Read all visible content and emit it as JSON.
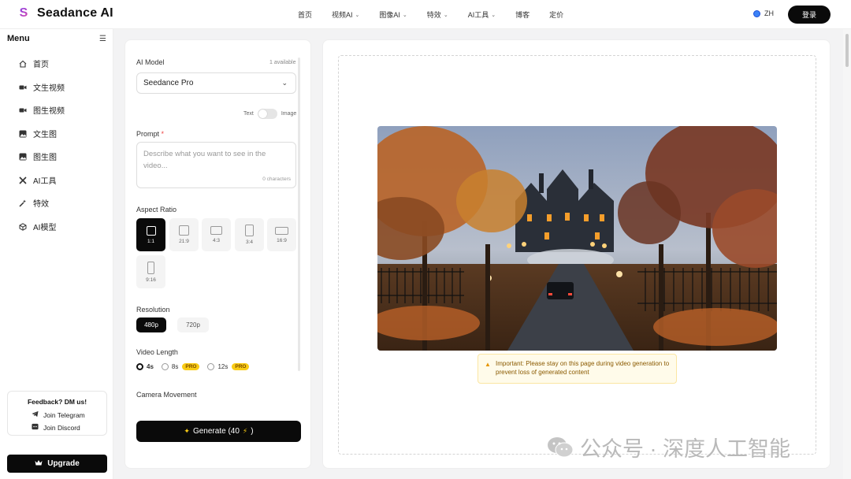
{
  "app": {
    "name": "Seadance AI",
    "logo_letter": "S"
  },
  "nav": {
    "items": [
      {
        "label": "首页",
        "has_dropdown": false
      },
      {
        "label": "视频AI",
        "has_dropdown": true
      },
      {
        "label": "图像AI",
        "has_dropdown": true
      },
      {
        "label": "特效",
        "has_dropdown": true
      },
      {
        "label": "AI工具",
        "has_dropdown": true
      },
      {
        "label": "博客",
        "has_dropdown": false
      },
      {
        "label": "定价",
        "has_dropdown": false
      }
    ],
    "language": "ZH",
    "login_label": "登录"
  },
  "sidebar": {
    "title": "Menu",
    "items": [
      {
        "label": "首页",
        "icon": "home-icon"
      },
      {
        "label": "文生视频",
        "icon": "video-icon"
      },
      {
        "label": "图生视频",
        "icon": "video-icon"
      },
      {
        "label": "文生图",
        "icon": "image-icon"
      },
      {
        "label": "图生图",
        "icon": "image-icon"
      },
      {
        "label": "AI工具",
        "icon": "tools-icon"
      },
      {
        "label": "特效",
        "icon": "magic-wand-icon"
      },
      {
        "label": "AI模型",
        "icon": "cube-icon"
      }
    ],
    "feedback": {
      "title": "Feedback? DM us!",
      "telegram": "Join Telegram",
      "discord": "Join Discord"
    },
    "upgrade_label": "Upgrade"
  },
  "form": {
    "model_label": "AI Model",
    "model_available": "1 available",
    "model_value": "Seedance Pro",
    "mode_text": "Text",
    "mode_image": "Image",
    "prompt_label": "Prompt",
    "prompt_required_mark": "*",
    "prompt_placeholder": "Describe what you want to see in the video...",
    "prompt_count": "0 characters",
    "aspect_label": "Aspect Ratio",
    "aspect_ratios": [
      "1:1",
      "21:9",
      "4:3",
      "3:4",
      "16:9",
      "9:16"
    ],
    "aspect_selected": "1:1",
    "resolution_label": "Resolution",
    "resolutions": [
      "480p",
      "720p"
    ],
    "resolution_selected": "480p",
    "length_label": "Video Length",
    "lengths": [
      {
        "label": "4s",
        "pro": false,
        "selected": true
      },
      {
        "label": "8s",
        "pro": true,
        "selected": false
      },
      {
        "label": "12s",
        "pro": true,
        "selected": false
      }
    ],
    "pro_badge": "PRO",
    "camera_label": "Camera Movement",
    "generate_label": "Generate (40",
    "generate_icon_left": "sparkle-icon",
    "generate_icon_right": "lightning-icon"
  },
  "output": {
    "warning": "Important: Please stay on this page during video generation to prevent loss of generated content"
  },
  "watermark": {
    "text": "公众号 · 深度人工智能"
  },
  "colors": {
    "accent": "#0a0a0a",
    "pro_badge": "#facc15",
    "warning_bg": "#fffbea",
    "warning_text": "#8a5a00"
  }
}
